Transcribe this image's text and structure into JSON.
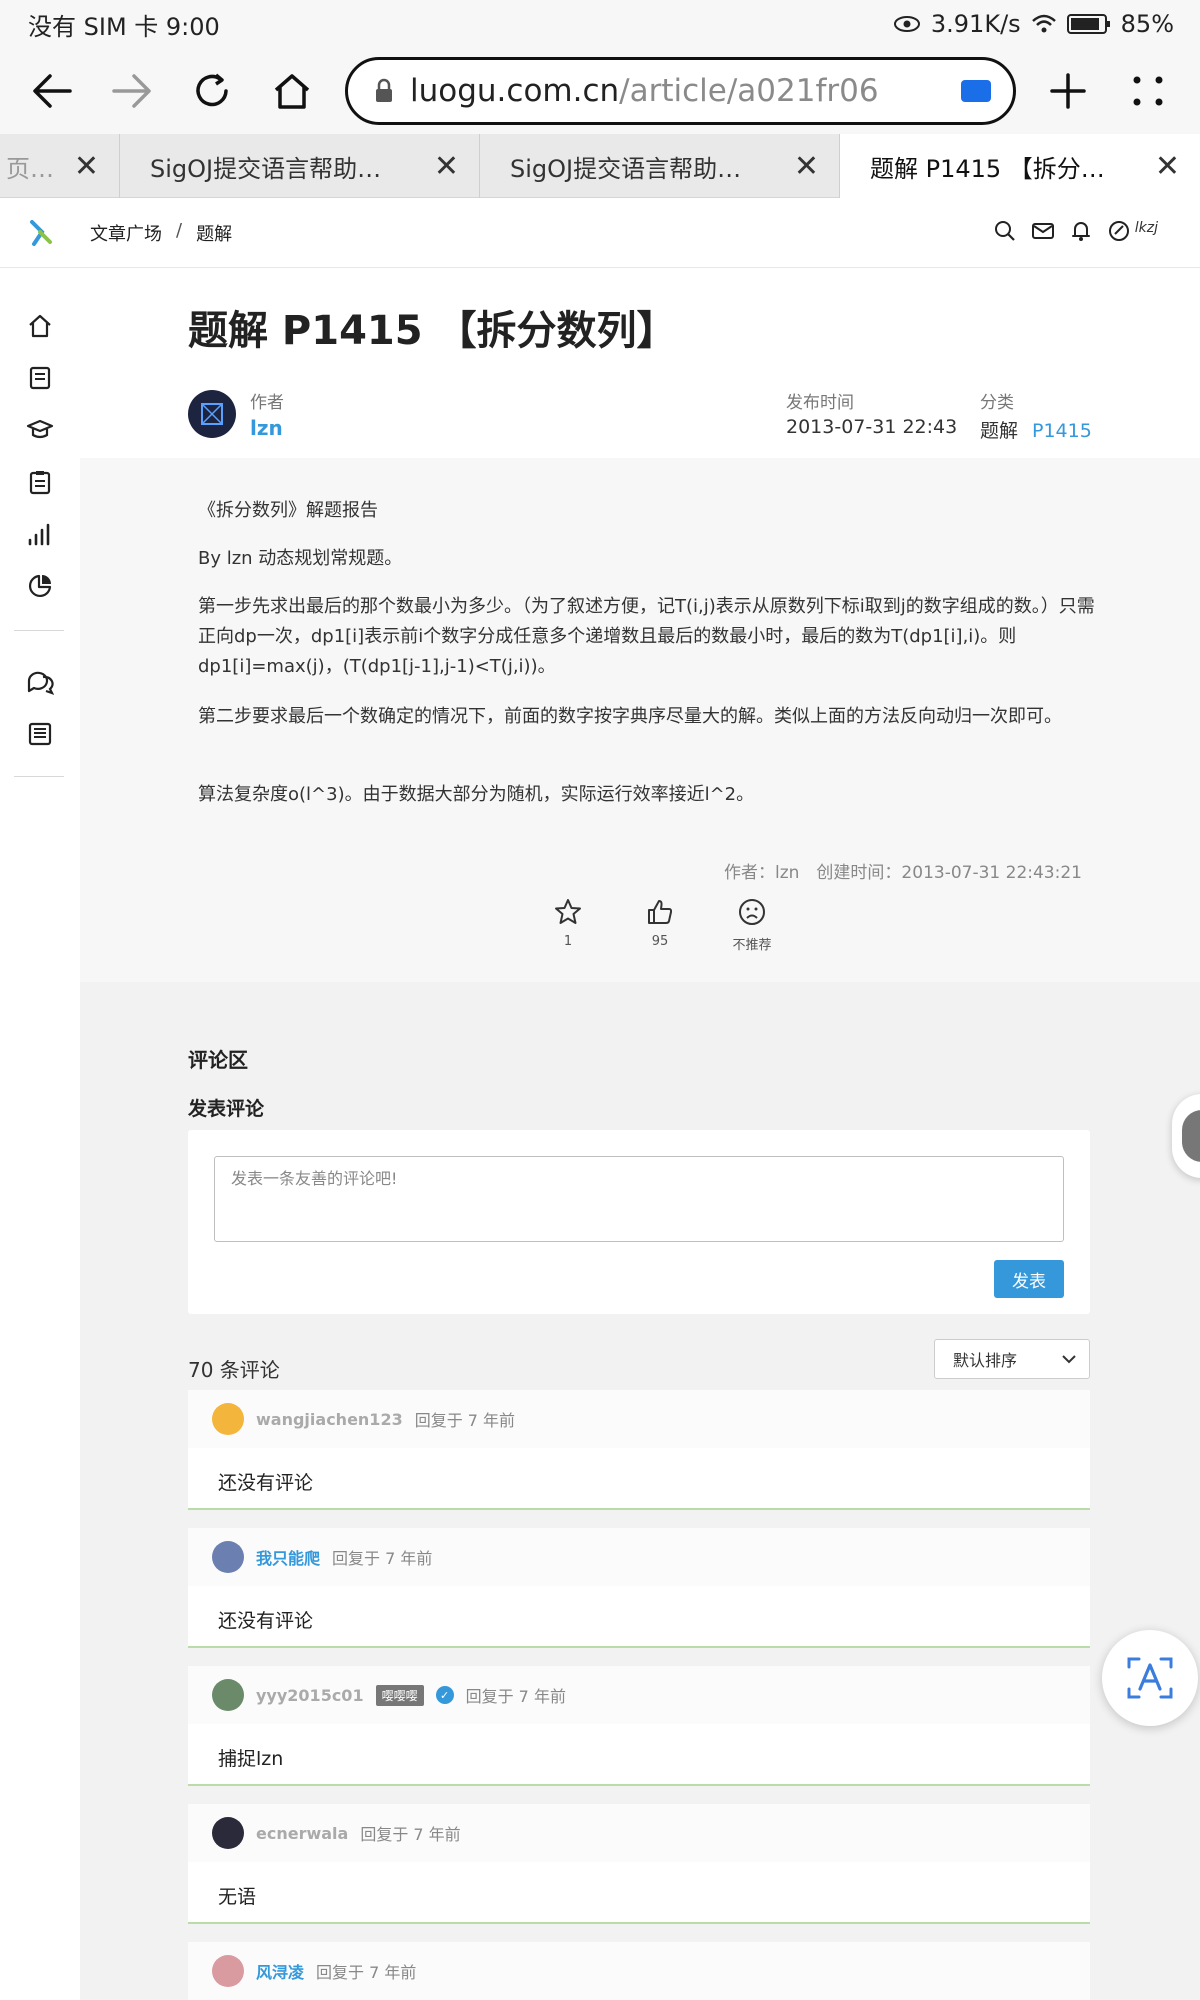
{
  "status_bar": {
    "carrier_time": "没有 SIM 卡 9:00",
    "net_speed": "3.91K/s",
    "battery": "85%"
  },
  "browser": {
    "url_host": "luogu.com.cn",
    "url_path": "/article/a021fr06",
    "tabs": [
      {
        "title": "页…",
        "active": false
      },
      {
        "title": "SigOJ提交语言帮助…",
        "active": false
      },
      {
        "title": "SigOJ提交语言帮助…",
        "active": false
      },
      {
        "title": "题解 P1415 【拆分…",
        "active": true
      }
    ]
  },
  "site_header": {
    "breadcrumb": [
      "文章广场",
      "/",
      "题解"
    ],
    "user_initials": "lkzj"
  },
  "article": {
    "title": "题解 P1415 【拆分数列】",
    "author_label": "作者",
    "author": "lzn",
    "published_label": "发布时间",
    "published": "2013-07-31 22:43",
    "category_label": "分类",
    "category": "题解",
    "problem_id": "P1415",
    "paragraphs": [
      "《拆分数列》解题报告",
      "By lzn 动态规划常规题。",
      "第一步先求出最后的那个数最小为多少。（为了叙述方便，记T(i,j)表示从原数列下标i取到j的数字组成的数。）只需正向dp一次，dp1[i]表示前i个数字分成任意多个递增数且最后的数最小时，最后的数为T(dp1[i],i)。则dp1[i]=max(j)，(T(dp1[j-1],j-1)<T(j,i))。",
      "第二步要求最后一个数确定的情况下，前面的数字按字典序尽量大的解。类似上面的方法反向动归一次即可。",
      "算法复杂度o(l^3)。由于数据大部分为随机，实际运行效率接近l^2。"
    ],
    "footer_meta": "作者：lzn　创建时间：2013-07-31 22:43:21",
    "reactions": {
      "star_count": "1",
      "like_count": "95",
      "dislike_label": "不推荐"
    }
  },
  "comments": {
    "section_title": "评论区",
    "post_title": "发表评论",
    "placeholder": "发表一条友善的评论吧!",
    "post_button": "发表",
    "count_label": "70 条评论",
    "sort_label": "默认排序",
    "items": [
      {
        "user": "wangjiachen123",
        "time": "回复于 7 年前",
        "text": "还没有评论",
        "avatar_color": "#f3b53c"
      },
      {
        "user": "我只能爬",
        "time": "回复于 7 年前",
        "text": "还没有评论",
        "avatar_color": "#6b7fb0"
      },
      {
        "user": "yyy2015c01",
        "badge": "嘤嘤嘤",
        "time": "回复于 7 年前",
        "text": "捕捉lzn",
        "avatar_color": "#6a8a6a"
      },
      {
        "user": "ecnerwala",
        "time": "回复于 7 年前",
        "text": "无语",
        "avatar_color": "#2a2a3a"
      },
      {
        "user": "风浔凌",
        "time": "回复于 7 年前",
        "text": "",
        "avatar_color": "#d99aa0"
      }
    ]
  }
}
